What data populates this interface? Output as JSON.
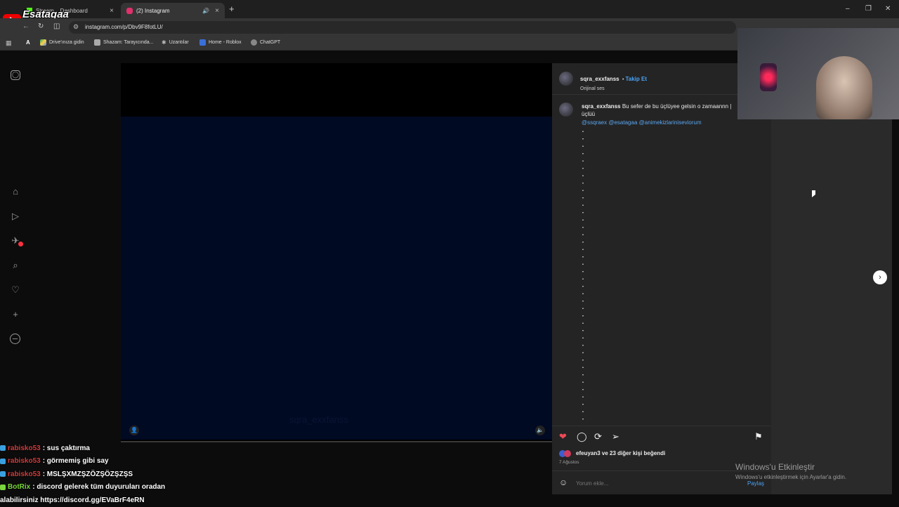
{
  "stream_logo": {
    "text": "Esatagaa"
  },
  "tabs": [
    {
      "label": "Stream... Dashboard",
      "color": "#53fc18"
    },
    {
      "label": "(2) Instagram",
      "color": "#e1306c"
    }
  ],
  "toolbar": {
    "url": "instagram.com/p/Dbv9F8fotLU/"
  },
  "bookmarks": [
    {
      "label": "Drive'ınıza gidin"
    },
    {
      "label": "Shazam: Tarayıcında..."
    },
    {
      "label": "Uzantılar"
    },
    {
      "label": "Home - Roblox"
    },
    {
      "label": "ChatGPT"
    }
  ],
  "post": {
    "author": "sqra_exxfanss",
    "follow_label": "Takip Et",
    "audio": "Orijinal ses",
    "caption_text": "Bu sefer de bu üçlüyee gelsin o zamaannn | üçlüü",
    "mentions": "@ssqraex @esatagaa @animekizlariniseviorum",
    "likes_user": "efeuyan3",
    "likes_rest": "ve 23 diğer kişi beğendi",
    "date": "7 Ağustos",
    "comment_placeholder": "Yorum ekle...",
    "share_label": "Paylaş",
    "video_watermark": "sqra_exxfanss"
  },
  "chat": [
    {
      "user": "rabisko53",
      "message": ": sus çaktırma"
    },
    {
      "user": "rabisko53",
      "message": ": görmemiş gibi say"
    },
    {
      "user": "rabisko53",
      "message": ": MSLŞXMZŞZÖZŞÖZŞZŞS"
    },
    {
      "user": "BotRix",
      "message": ": discord gelerek tüm duyuruları oradan"
    },
    {
      "user": "",
      "message": "alabilirsiniz https://discord.gg/EVaBrF4eRN"
    }
  ],
  "windows_activation": {
    "title": "Windows'u Etkinleştir",
    "subtitle": "Windows'u etkinleştirmek için Ayarlar'a gidin."
  },
  "colors": {
    "like": "#ed4956",
    "link": "#4aa3f5",
    "chat_user": "#d23b3b",
    "bot": "#7ad63c"
  }
}
